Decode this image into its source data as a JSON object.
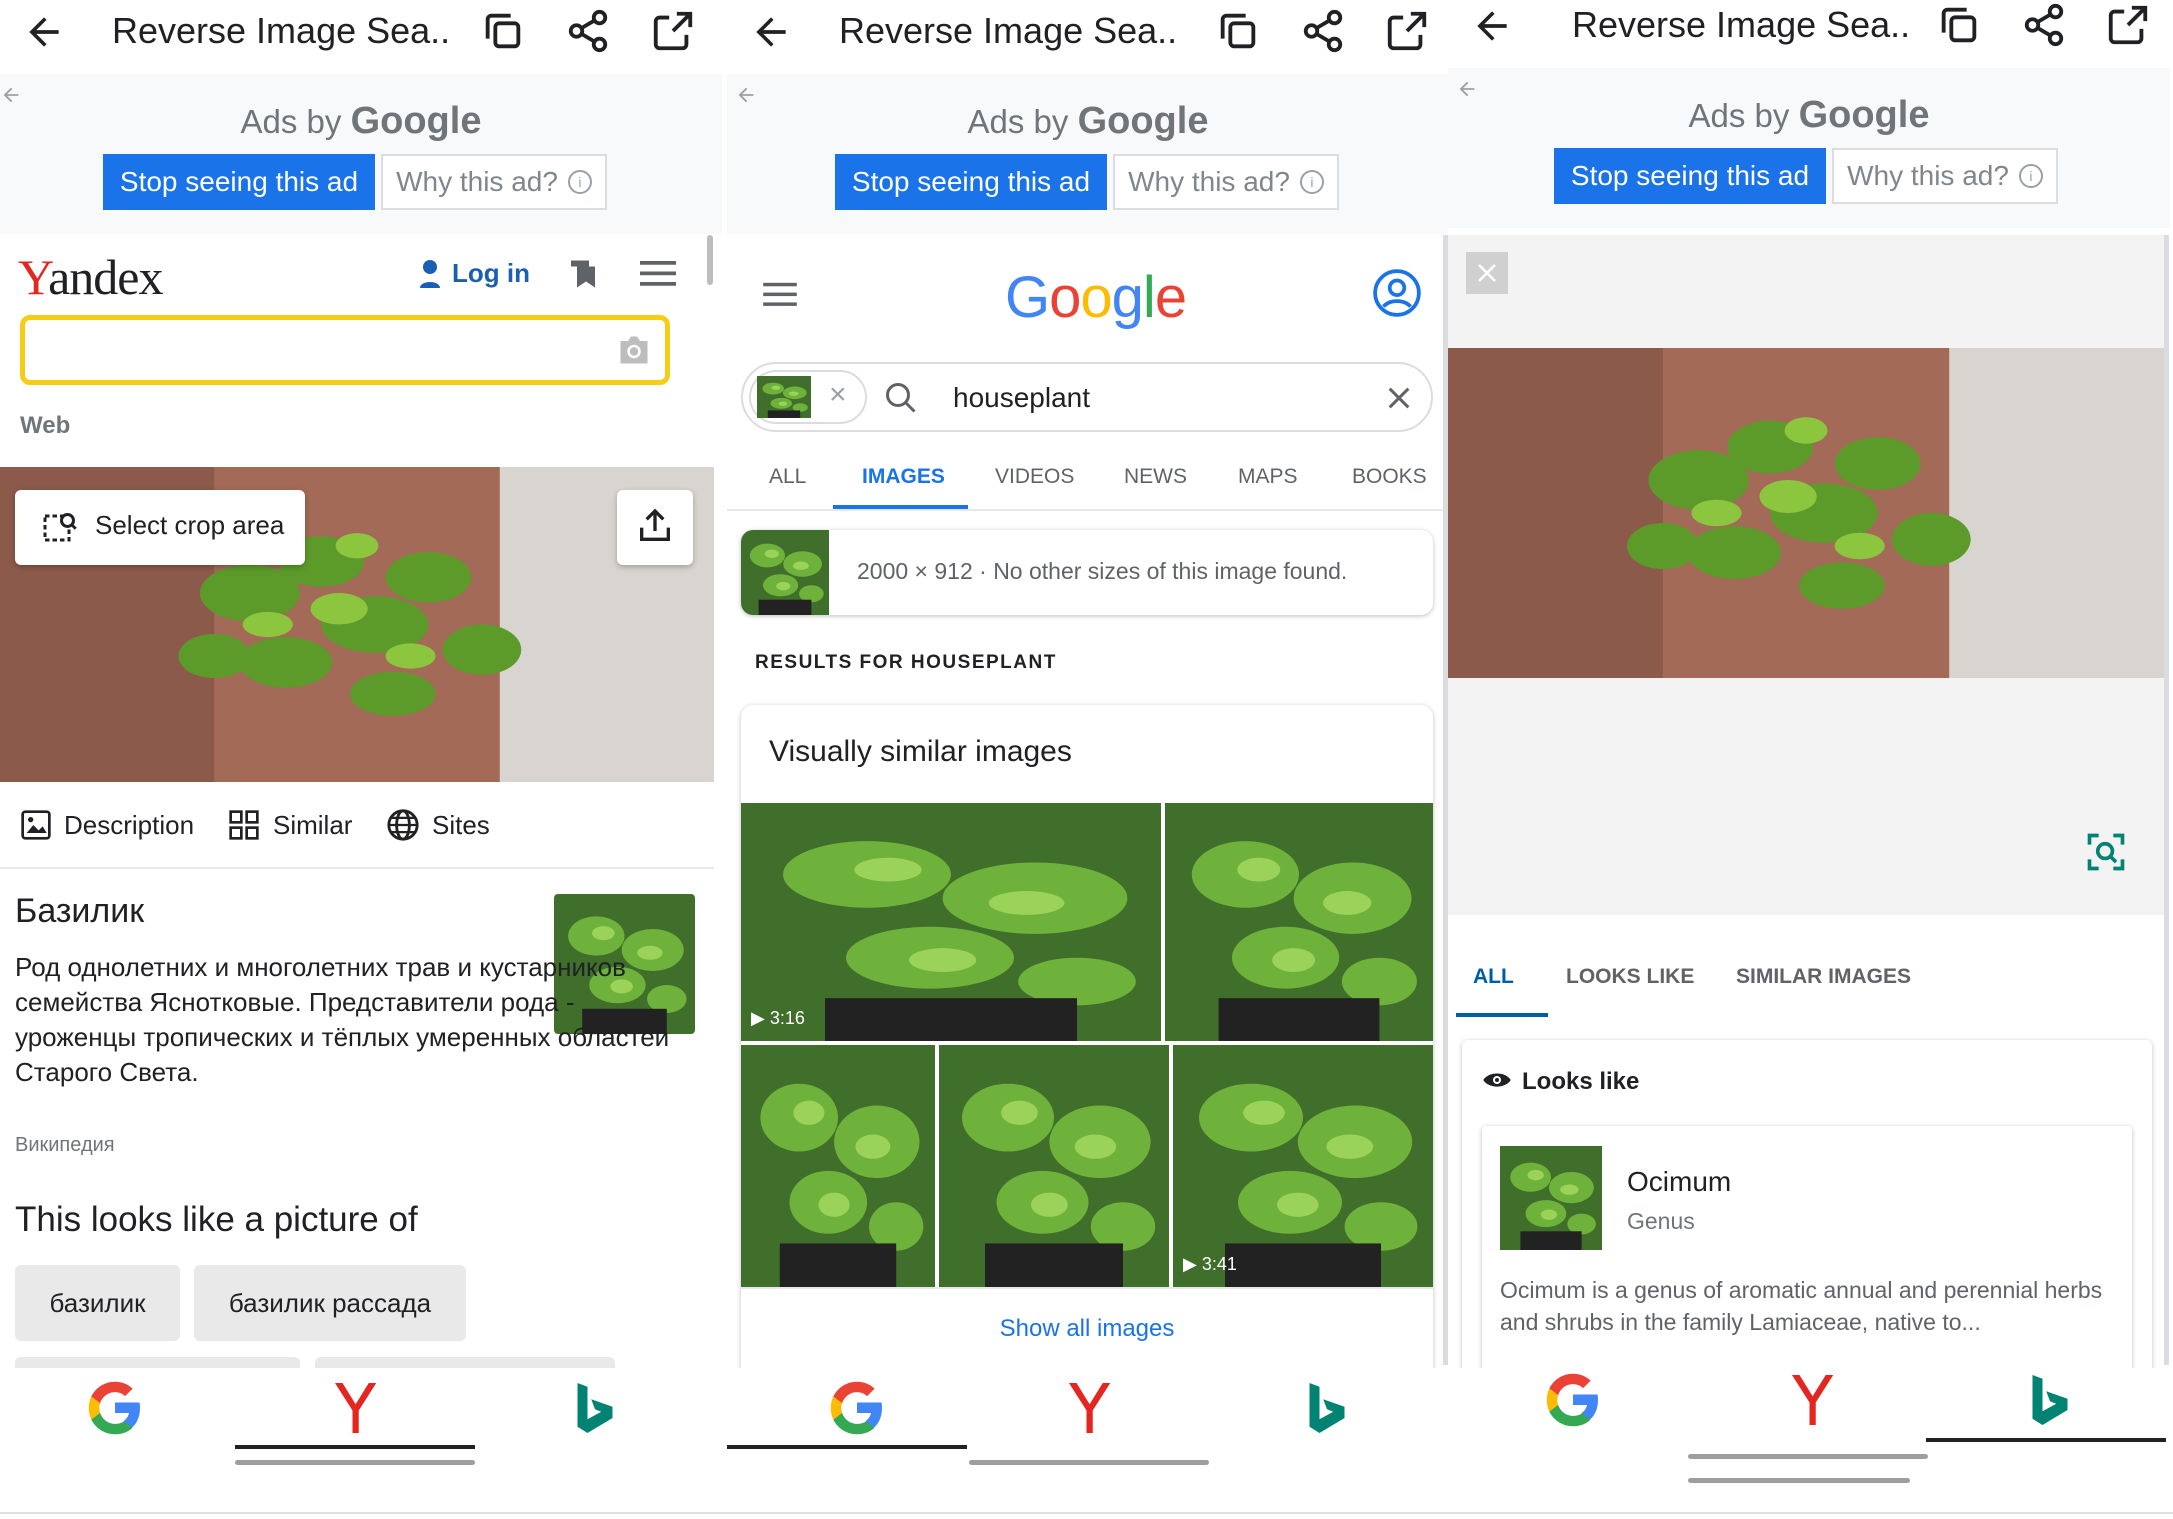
{
  "topbar": {
    "title": "Reverse Image Sea..."
  },
  "ads": {
    "ads_by": "Ads by",
    "ads_brand": "Google",
    "stop_label": "Stop seeing this ad",
    "why_label": "Why this ad?",
    "why_icon": "i"
  },
  "yandex": {
    "logo_first": "Y",
    "logo_rest": "andex",
    "login_label": "Log in",
    "search_value": "",
    "web_label": "Web",
    "crop_label": "Select crop area",
    "tabs": [
      {
        "label": "Description"
      },
      {
        "label": "Similar"
      },
      {
        "label": "Sites"
      }
    ],
    "result_title": "Базилик",
    "result_text": "Род однолетних и многолетних трав и кустарников семейства Яснотковые. Представители рода - уроженцы тропических и тёплых умеренных областей Старого Света.",
    "result_source": "Википедия",
    "looks_like_heading": "This looks like a picture of",
    "tags": [
      "базилик",
      "базилик рассада"
    ]
  },
  "google": {
    "logo": "Google",
    "search_value": "houseplant",
    "tabs": [
      "ALL",
      "IMAGES",
      "VIDEOS",
      "NEWS",
      "MAPS",
      "BOOKS"
    ],
    "active_tab": "IMAGES",
    "size_info": "2000 × 912 · No other sizes of this image found.",
    "results_heading": "RESULTS FOR HOUSEPLANT",
    "similar_heading": "Visually similar images",
    "durations": [
      "3:16",
      "3:41"
    ],
    "show_all": "Show all images"
  },
  "bing": {
    "tabs": [
      "ALL",
      "LOOKS LIKE",
      "SIMILAR IMAGES"
    ],
    "active_tab": "ALL",
    "looks_like_heading": "Looks like",
    "entity_name": "Ocimum",
    "entity_type": "Genus",
    "entity_desc": "Ocimum is a genus of aromatic annual and perennial herbs and shrubs in the family Lamiaceae, native to..."
  },
  "bottom_nav": [
    "google-tab",
    "yandex-tab",
    "bing-tab"
  ],
  "colors": {
    "ad_blue": "#1a73e8",
    "yandex_red": "#e52620",
    "yandex_yellow": "#f6cd16",
    "google_blue": "#4285f4",
    "google_red": "#ea4335",
    "google_yellow": "#fbbc05",
    "google_green": "#34a853",
    "bing_teal": "#008373",
    "link_blue": "#1a73e8"
  }
}
